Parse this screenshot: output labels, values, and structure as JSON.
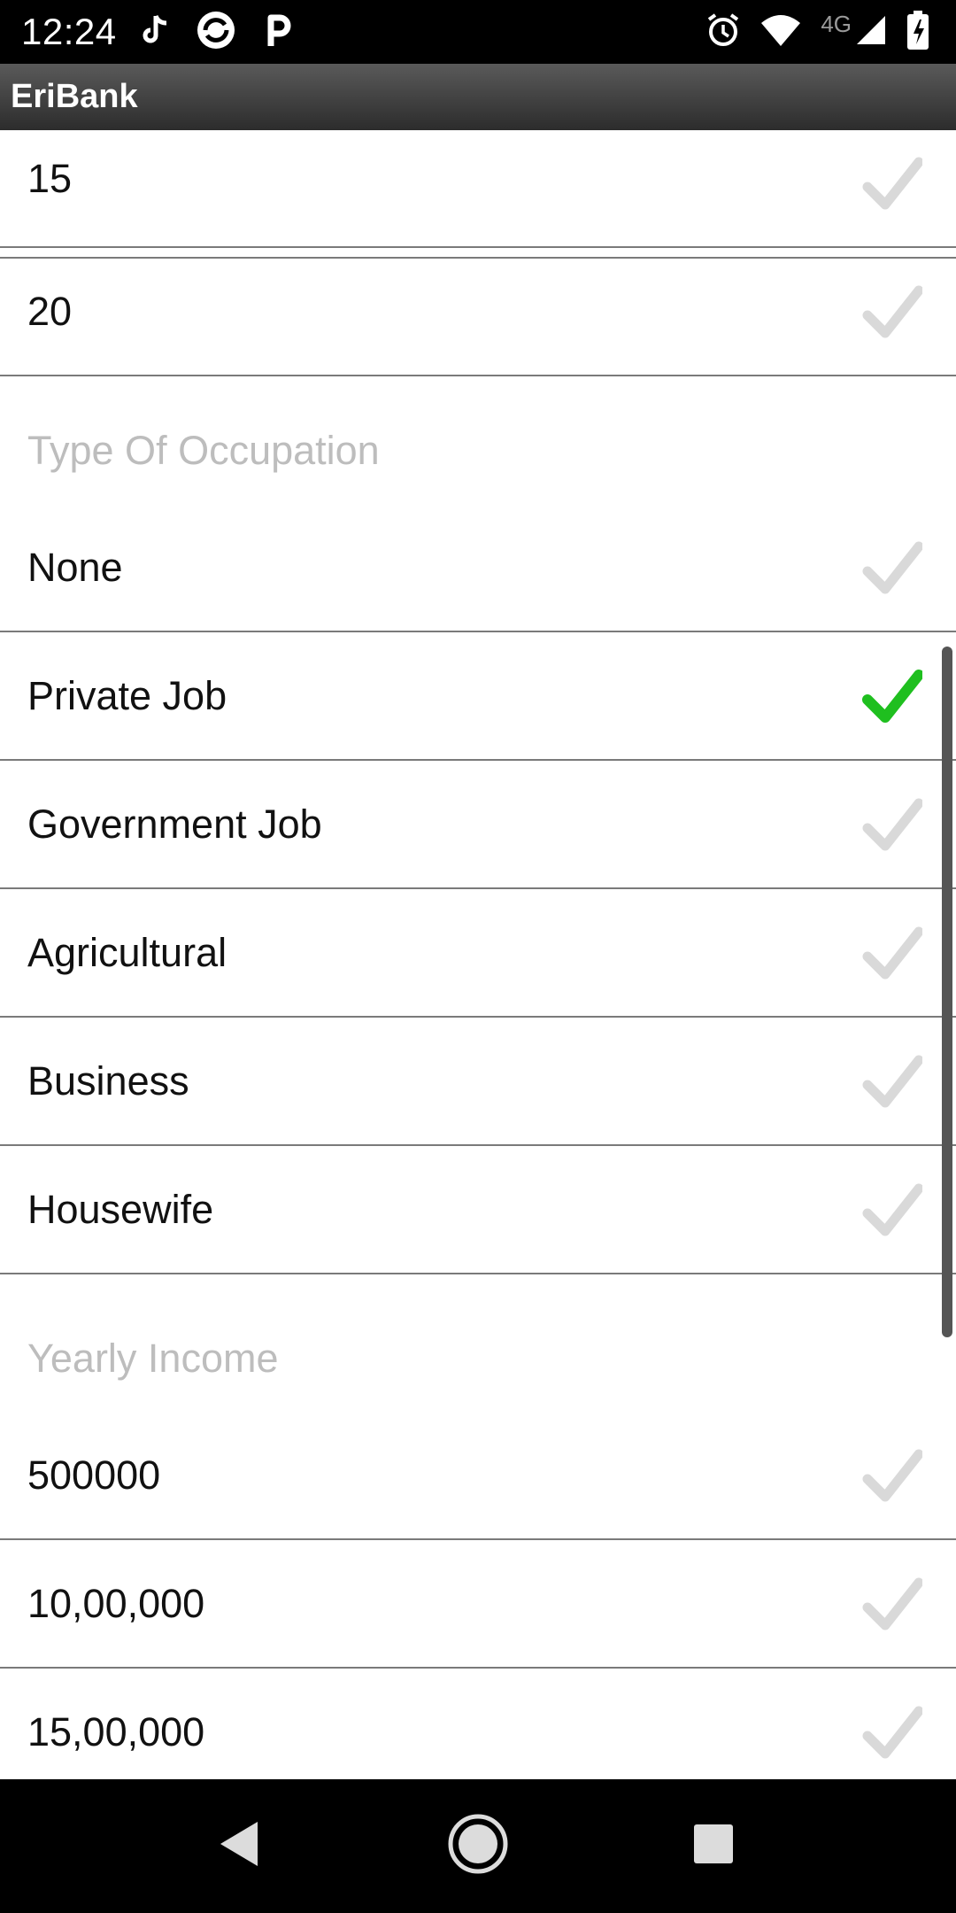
{
  "status_bar": {
    "time": "12:24",
    "left_icons": [
      "tiktok-icon",
      "sync-icon",
      "parking-icon"
    ],
    "right_icons": [
      "alarm-icon",
      "wifi-icon",
      "signal-icon",
      "battery-icon"
    ],
    "network_label": "4G"
  },
  "app_bar": {
    "title": "EriBank"
  },
  "colors": {
    "checked": "#1fbf1f",
    "unchecked": "#d9d9d9",
    "section_header": "#bdbdbd",
    "divider": "#7a7a7a"
  },
  "list": {
    "top_items": [
      {
        "label": "15",
        "checked": false
      },
      {
        "label": "20",
        "checked": false
      }
    ],
    "occupation": {
      "header": "Type Of Occupation",
      "items": [
        {
          "label": "None",
          "checked": false
        },
        {
          "label": "Private Job",
          "checked": true
        },
        {
          "label": "Government Job",
          "checked": false
        },
        {
          "label": "Agricultural",
          "checked": false
        },
        {
          "label": "Business",
          "checked": false
        },
        {
          "label": "Housewife",
          "checked": false
        }
      ]
    },
    "income": {
      "header": "Yearly Income",
      "items": [
        {
          "label": "500000",
          "checked": false
        },
        {
          "label": "10,00,000",
          "checked": false
        },
        {
          "label": "15,00,000",
          "checked": false
        }
      ]
    }
  },
  "nav_bar": {
    "buttons": [
      "back-icon",
      "home-icon",
      "recents-icon"
    ]
  }
}
